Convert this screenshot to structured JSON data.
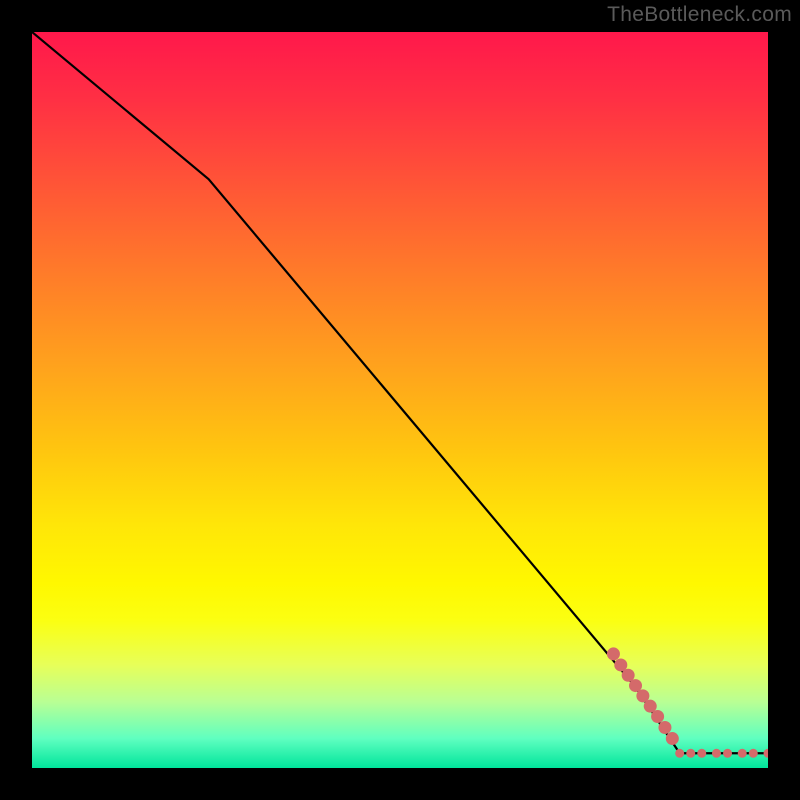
{
  "watermark": "TheBottleneck.com",
  "chart_data": {
    "type": "line",
    "title": "",
    "xlabel": "",
    "ylabel": "",
    "xlim": [
      0,
      100
    ],
    "ylim": [
      0,
      100
    ],
    "series": [
      {
        "name": "curve",
        "stroke": "#000000",
        "stroke_width": 2.2,
        "points": [
          {
            "x": 0,
            "y": 100
          },
          {
            "x": 24,
            "y": 80
          },
          {
            "x": 82,
            "y": 11
          },
          {
            "x": 88,
            "y": 2
          },
          {
            "x": 100,
            "y": 2
          }
        ]
      },
      {
        "name": "markers",
        "color": "#d46a6a",
        "marker_radius_large": 6.5,
        "marker_radius_small": 4.5,
        "points": [
          {
            "x": 79,
            "y": 15.5,
            "r": "large"
          },
          {
            "x": 80,
            "y": 14.0,
            "r": "large"
          },
          {
            "x": 81,
            "y": 12.6,
            "r": "large"
          },
          {
            "x": 82,
            "y": 11.2,
            "r": "large"
          },
          {
            "x": 83,
            "y": 9.8,
            "r": "large"
          },
          {
            "x": 84,
            "y": 8.4,
            "r": "large"
          },
          {
            "x": 85,
            "y": 7.0,
            "r": "large"
          },
          {
            "x": 86,
            "y": 5.5,
            "r": "large"
          },
          {
            "x": 87,
            "y": 4.0,
            "r": "large"
          },
          {
            "x": 88,
            "y": 2.0,
            "r": "small"
          },
          {
            "x": 89.5,
            "y": 2.0,
            "r": "small"
          },
          {
            "x": 91,
            "y": 2.0,
            "r": "small"
          },
          {
            "x": 93,
            "y": 2.0,
            "r": "small"
          },
          {
            "x": 94.5,
            "y": 2.0,
            "r": "small"
          },
          {
            "x": 96.5,
            "y": 2.0,
            "r": "small"
          },
          {
            "x": 98,
            "y": 2.0,
            "r": "small"
          },
          {
            "x": 100,
            "y": 2.0,
            "r": "small"
          }
        ]
      }
    ],
    "gradient_stops": [
      {
        "offset": 0,
        "color": "#ff184b"
      },
      {
        "offset": 9,
        "color": "#ff2f44"
      },
      {
        "offset": 22,
        "color": "#ff5935"
      },
      {
        "offset": 33,
        "color": "#ff7c29"
      },
      {
        "offset": 45,
        "color": "#ffa11d"
      },
      {
        "offset": 57,
        "color": "#ffc60f"
      },
      {
        "offset": 67,
        "color": "#ffe608"
      },
      {
        "offset": 75,
        "color": "#fff800"
      },
      {
        "offset": 80,
        "color": "#fbff12"
      },
      {
        "offset": 86,
        "color": "#e7ff59"
      },
      {
        "offset": 91,
        "color": "#b9ff94"
      },
      {
        "offset": 96,
        "color": "#5fffc0"
      },
      {
        "offset": 100,
        "color": "#00e59b"
      }
    ]
  }
}
